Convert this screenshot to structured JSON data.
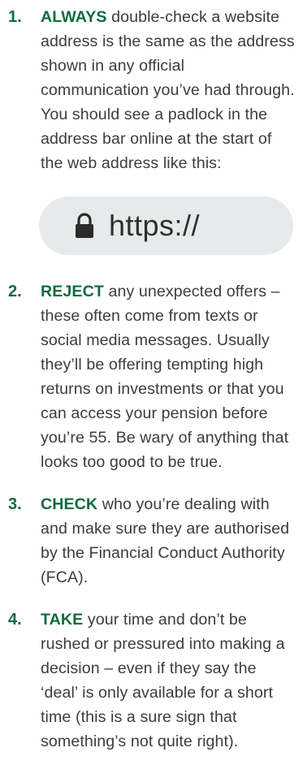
{
  "tips": [
    {
      "number": "1.",
      "keyword": "ALWAYS",
      "text": " double-check a website address is the same as the address shown in any official communication you’ve had through. You should see a padlock in the address bar online at the start of the web address like this:"
    },
    {
      "number": "2.",
      "keyword": "REJECT",
      "text": " any unexpected offers – these often come from texts or social media messages. Usually they’ll be offering tempting high returns on investments or that you can access your pension before you’re 55.  Be wary of anything that looks too good to be true."
    },
    {
      "number": "3.",
      "keyword": "CHECK",
      "text": " who you’re dealing with and make sure they are authorised by the Financial Conduct Authority (FCA)."
    },
    {
      "number": "4.",
      "keyword": "TAKE",
      "text": " your time and don’t be rushed or pressured into making a decision – even if they say the ‘deal’ is only available for a short time (this is a sure sign that something’s not quite right)."
    }
  ],
  "addressbar": {
    "url": "https://",
    "icon": "padlock-icon"
  },
  "colors": {
    "accent": "#0f6b3f",
    "body_text": "#3c3c3c",
    "address_bg": "#e7eaea"
  }
}
